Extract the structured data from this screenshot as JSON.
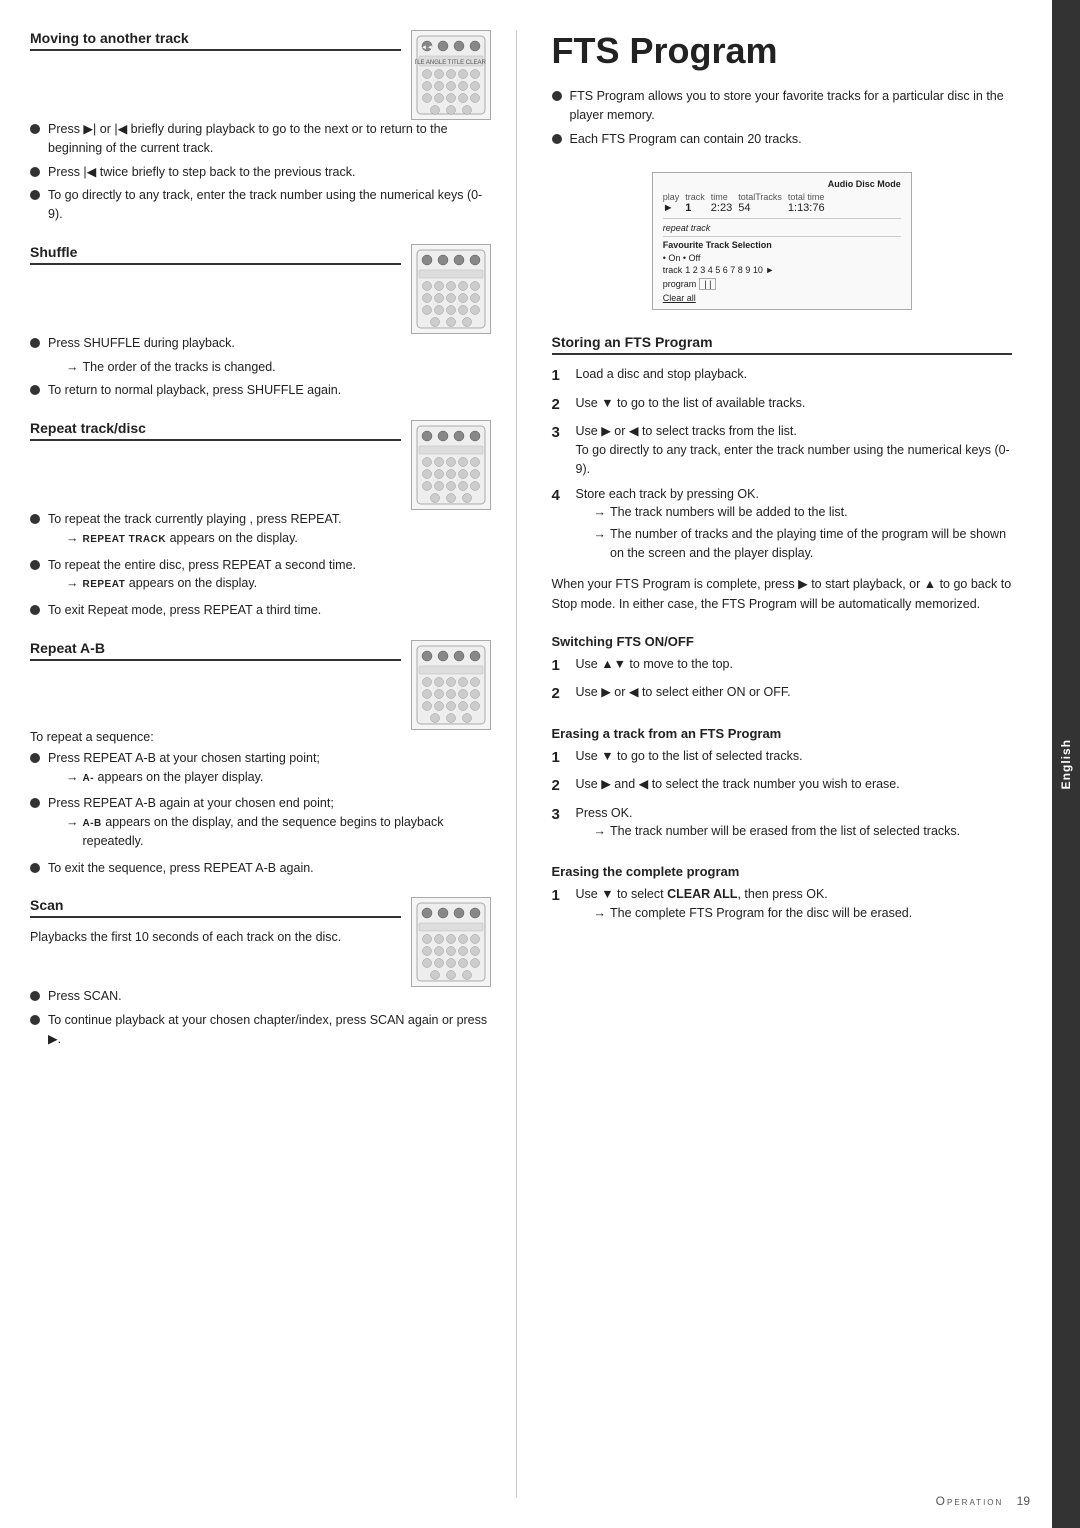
{
  "side_tab": {
    "label": "English"
  },
  "left_col": {
    "sections": [
      {
        "id": "moving",
        "heading": "Moving to another track",
        "bullets": [
          "Press ▶| or |◀ briefly during playback to go to the next or to return to the beginning of the current track.",
          "Press |◀ twice briefly to step back to the previous track.",
          "To go directly to any track, enter the track number using the numerical keys (0-9)."
        ],
        "has_remote": true
      },
      {
        "id": "shuffle",
        "heading": "Shuffle",
        "bullets": [
          "Press SHUFFLE during playback.",
          "→ The order of the tracks is changed.",
          "To return to normal playback, press SHUFFLE again."
        ],
        "has_remote": true
      },
      {
        "id": "repeat",
        "heading": "Repeat track/disc",
        "bullets": [
          "To repeat the track currently playing , press REPEAT.",
          "→ REPEAT TRACK appears on the display.",
          "To repeat the entire disc, press REPEAT a second time.",
          "→ REPEAT appears on the display.",
          "To exit Repeat mode, press REPEAT a third time."
        ],
        "has_remote": true
      },
      {
        "id": "repeat-ab",
        "heading": "Repeat A-B",
        "bullets": [
          "To repeat a sequence:",
          "Press REPEAT A-B at your chosen starting point;",
          "→ A- appears on the player display.",
          "Press REPEAT A-B again at your chosen end point;",
          "→ A-B appears on the display, and the sequence begins to playback repeatedly.",
          "To exit the sequence, press REPEAT A-B again."
        ],
        "has_remote": true
      },
      {
        "id": "scan",
        "heading": "Scan",
        "description": "Playbacks the first 10 seconds of each track on the disc.",
        "bullets": [
          "Press SCAN.",
          "To continue playback at your chosen chapter/index, press SCAN again or press ▶."
        ],
        "has_remote": true
      }
    ]
  },
  "right_col": {
    "title": "FTS Program",
    "intro_bullets": [
      "FTS Program allows you to store your favorite tracks for a particular disc in the player memory.",
      "Each FTS Program can contain 20 tracks."
    ],
    "storing_section": {
      "heading": "Storing an FTS Program",
      "steps": [
        "Load a disc and stop playback.",
        "Use ▼ to go to the list of available tracks.",
        "Use ▶ or ◀ to select tracks from the list. To go directly to any track, enter the track number using the numerical keys (0-9).",
        "Store each track by pressing OK.\n→ The track numbers will be added to the list.\n→ The number of tracks and the playing time of the program will be shown on the screen and the player display.",
        "When your FTS Program is complete, press ▶ to start playback, or ▲ to go back to Stop mode. In either case, the FTS Program will be automatically memorized."
      ]
    },
    "switching_section": {
      "heading": "Switching FTS ON/OFF",
      "steps": [
        "Use ▲▼ to move to the top.",
        "Use ▶ or ◀ to select either ON or OFF."
      ]
    },
    "erasing_track_section": {
      "heading": "Erasing a track from an FTS Program",
      "steps": [
        "Use ▼ to go to the list of selected tracks.",
        "Use ▶ and ◀ to select the track number you wish to erase.",
        "Press OK.\n→ The track number will be erased from the list of selected tracks."
      ]
    },
    "erasing_complete_section": {
      "heading": "Erasing the complete program",
      "steps": [
        "Use ▼ to select CLEAR ALL, then press OK.\n→ The complete FTS Program for the disc will be erased."
      ]
    }
  },
  "footer": {
    "label": "Operation",
    "page_num": "19"
  },
  "display": {
    "audio_disc_mode": "Audio Disc Mode",
    "play": "►",
    "track_label": "track",
    "time_label": "time",
    "total_tracks_label": "totalTracks",
    "total_time_label": "total time",
    "track_val": "1",
    "time_val": "2:23",
    "total_tracks_val": "54",
    "total_time_val": "1:13:76",
    "repeat_track_label": "repeat track",
    "fav_label": "Favourite Track Selection",
    "on_off": "• On • Off",
    "track_row_label": "track",
    "track_nums": [
      "1",
      "2",
      "3",
      "4",
      "5",
      "6",
      "7",
      "8",
      "9",
      "10 ►"
    ],
    "program_label": "program",
    "program_val": "| |",
    "clear_all": "Clear all"
  }
}
